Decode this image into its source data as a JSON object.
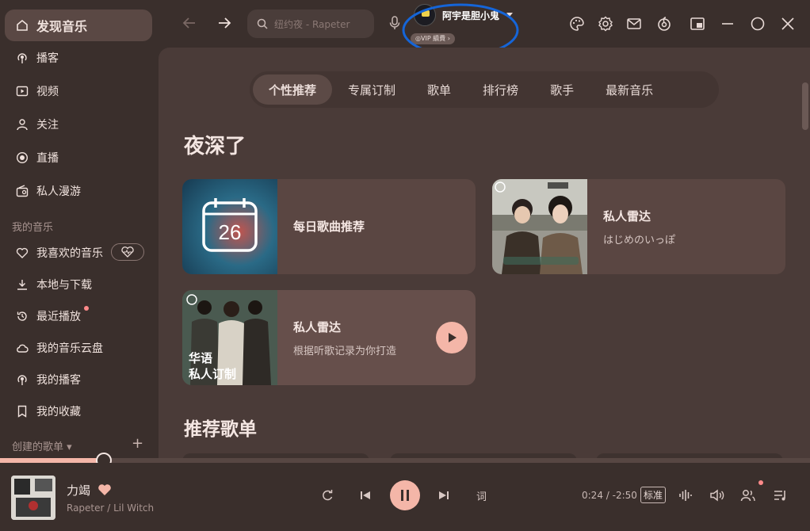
{
  "sidebar": {
    "items": [
      {
        "label": "发现音乐"
      },
      {
        "label": "播客"
      },
      {
        "label": "视频"
      },
      {
        "label": "关注"
      },
      {
        "label": "直播"
      },
      {
        "label": "私人漫游"
      }
    ],
    "my_music_title": "我的音乐",
    "my_music": [
      {
        "label": "我喜欢的音乐"
      },
      {
        "label": "本地与下载"
      },
      {
        "label": "最近播放"
      },
      {
        "label": "我的音乐云盘"
      },
      {
        "label": "我的播客"
      },
      {
        "label": "我的收藏"
      }
    ],
    "created_playlists_title": "创建的歌单 ▾"
  },
  "topbar": {
    "search_placeholder": "纽约夜 - Rapeter",
    "user_name": "阿宇是胆小鬼",
    "vip_badge": "◎VIP 續費 ›",
    "colors": {
      "annotation_circle": "#1565d8"
    }
  },
  "main": {
    "tabs": [
      {
        "label": "个性推荐",
        "active": true
      },
      {
        "label": "专属订制"
      },
      {
        "label": "歌单"
      },
      {
        "label": "排行榜"
      },
      {
        "label": "歌手"
      },
      {
        "label": "最新音乐"
      }
    ],
    "section_title": "夜深了",
    "cards": [
      {
        "title": "每日歌曲推荐",
        "subtitle": "",
        "calendar_day": "26"
      },
      {
        "title": "私人雷达",
        "subtitle": "はじめのいっぽ"
      },
      {
        "title": "私人雷达",
        "subtitle": "根据听歌记录为你打造",
        "cover_text": "华语\n私人订制"
      }
    ],
    "section2_title": "推荐歌单"
  },
  "player": {
    "song_title": "力竭",
    "artist": "Rapeter / Lil Witch",
    "lyric_label": "词",
    "time": "0:24 / -2:50",
    "quality": "标准",
    "progress": 0.128
  },
  "colors": {
    "accent": "#f4b6a8",
    "background": "#3a2f2c",
    "panel": "#4a3b38"
  }
}
